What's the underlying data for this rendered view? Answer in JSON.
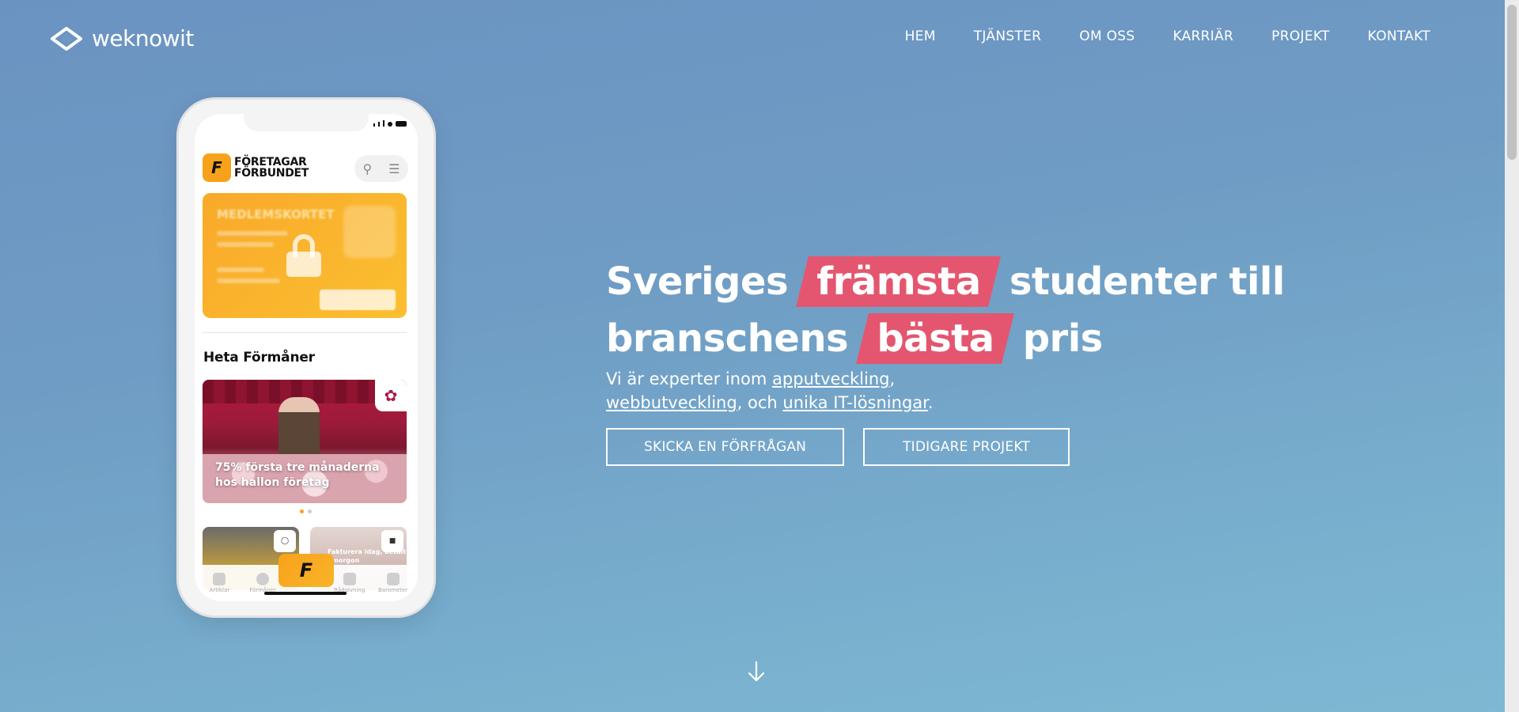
{
  "header": {
    "logo_text": "weknowit",
    "nav": [
      {
        "label": "HEM"
      },
      {
        "label": "TJÄNSTER"
      },
      {
        "label": "OM OSS"
      },
      {
        "label": "KARRIÄR"
      },
      {
        "label": "PROJEKT"
      },
      {
        "label": "KONTAKT"
      }
    ]
  },
  "phone": {
    "app_logo_letter": "F",
    "app_brand_line1": "FÖRETAGAR",
    "app_brand_line2": "FÖRBUNDET",
    "card_title": "MEDLEMSKORTET",
    "section_title": "Heta Förmåner",
    "promo_caption": "75% första tre månaderna hos hallon företag",
    "mini_card_caption": "Fakturera idag, betalt i morgon",
    "tabs": [
      "Artiklar",
      "Förmåner",
      "",
      "Rådgivning",
      "Barometer"
    ],
    "center_tab_letter": "F"
  },
  "hero": {
    "title_part1": "Sveriges",
    "title_highlight1": "främsta",
    "title_part2": "studenter till branschens",
    "title_highlight2": "bästa",
    "title_part3": "pris",
    "sub_prefix": "Vi är experter inom ",
    "link1": "apputveckling",
    "sub_sep1": ",",
    "link2": "webbutveckling",
    "sub_sep2": ", och ",
    "link3": "unika IT-lösningar",
    "sub_end": ".",
    "button_primary": "SKICKA EN FÖRFRÅGAN",
    "button_secondary": "TIDIGARE PROJEKT"
  },
  "colors": {
    "highlight": "#e4566f",
    "brand_orange": "#f7a21b",
    "background_top": "#6b93c2",
    "background_bottom": "#7db9d3"
  },
  "icons": {
    "logo": "weknowit-diamond-logo-icon",
    "scroll_down": "arrow-down-icon",
    "search": "search-icon",
    "menu": "hamburger-icon",
    "lock": "lock-icon"
  }
}
